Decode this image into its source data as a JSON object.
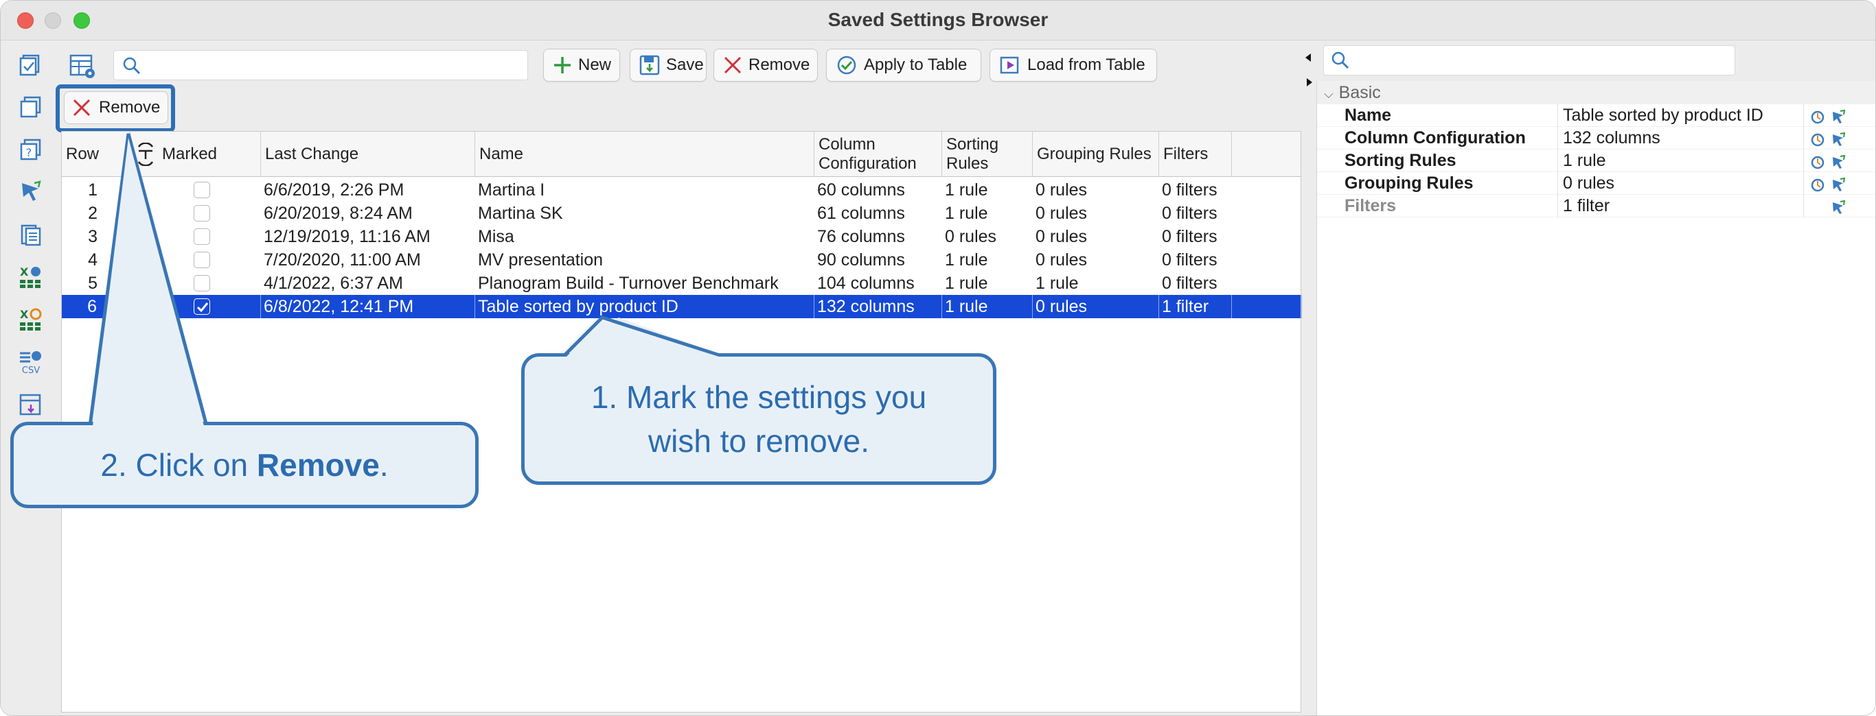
{
  "window": {
    "title": "Saved Settings Browser"
  },
  "toolbar": {
    "buttons": [
      {
        "label": "New",
        "icon": "plus-icon"
      },
      {
        "label": "Save",
        "icon": "save-icon"
      },
      {
        "label": "Remove",
        "icon": "close-x-icon"
      },
      {
        "label": "Apply to Table",
        "icon": "apply-icon"
      },
      {
        "label": "Load from Table",
        "icon": "load-icon"
      }
    ],
    "remove_small_label": "Remove"
  },
  "table": {
    "headers": [
      "Row",
      "Marked",
      "Last Change",
      "Name",
      "Column Configuration",
      "Sorting Rules",
      "Grouping Rules",
      "Filters"
    ],
    "rows": [
      {
        "row": "1",
        "marked": false,
        "last_change": "6/6/2019, 2:26 PM",
        "name": "Martina I",
        "columns": "60 columns",
        "sorting": "1 rule",
        "grouping": "0 rules",
        "filters": "0 filters",
        "selected": false
      },
      {
        "row": "2",
        "marked": false,
        "last_change": "6/20/2019, 8:24 AM",
        "name": "Martina SK",
        "columns": "61 columns",
        "sorting": "1 rule",
        "grouping": "0 rules",
        "filters": "0 filters",
        "selected": false
      },
      {
        "row": "3",
        "marked": false,
        "last_change": "12/19/2019, 11:16 AM",
        "name": "Misa",
        "columns": "76 columns",
        "sorting": "0 rules",
        "grouping": "0 rules",
        "filters": "0 filters",
        "selected": false
      },
      {
        "row": "4",
        "marked": false,
        "last_change": "7/20/2020, 11:00 AM",
        "name": "MV presentation",
        "columns": "90 columns",
        "sorting": "1 rule",
        "grouping": "0 rules",
        "filters": "0 filters",
        "selected": false
      },
      {
        "row": "5",
        "marked": false,
        "last_change": "4/1/2022, 6:37 AM",
        "name": "Planogram Build - Turnover Benchmark",
        "columns": "104 columns",
        "sorting": "1 rule",
        "grouping": "1 rule",
        "filters": "0 filters",
        "selected": false
      },
      {
        "row": "6",
        "marked": true,
        "last_change": "6/8/2022, 12:41 PM",
        "name": "Table sorted by product ID",
        "columns": "132 columns",
        "sorting": "1 rule",
        "grouping": "0 rules",
        "filters": "1 filter",
        "selected": true
      }
    ]
  },
  "properties": {
    "group": "Basic",
    "items": [
      {
        "name": "Name",
        "value": "Table sorted by product ID",
        "muted": false
      },
      {
        "name": "Column Configuration",
        "value": "132 columns",
        "muted": false
      },
      {
        "name": "Sorting Rules",
        "value": "1 rule",
        "muted": false
      },
      {
        "name": "Grouping Rules",
        "value": "0 rules",
        "muted": false
      },
      {
        "name": "Filters",
        "value": "1 filter",
        "muted": true
      }
    ]
  },
  "callouts": {
    "step1": "1. Mark the settings you wish to remove.",
    "step2_prefix": "2. Click on ",
    "step2_bold": "Remove",
    "step2_suffix": "."
  },
  "colors": {
    "selection": "#1649d6",
    "callout_border": "#3a76b4",
    "callout_fill": "#e8f0f7",
    "callout_text": "#2b6cb0"
  }
}
